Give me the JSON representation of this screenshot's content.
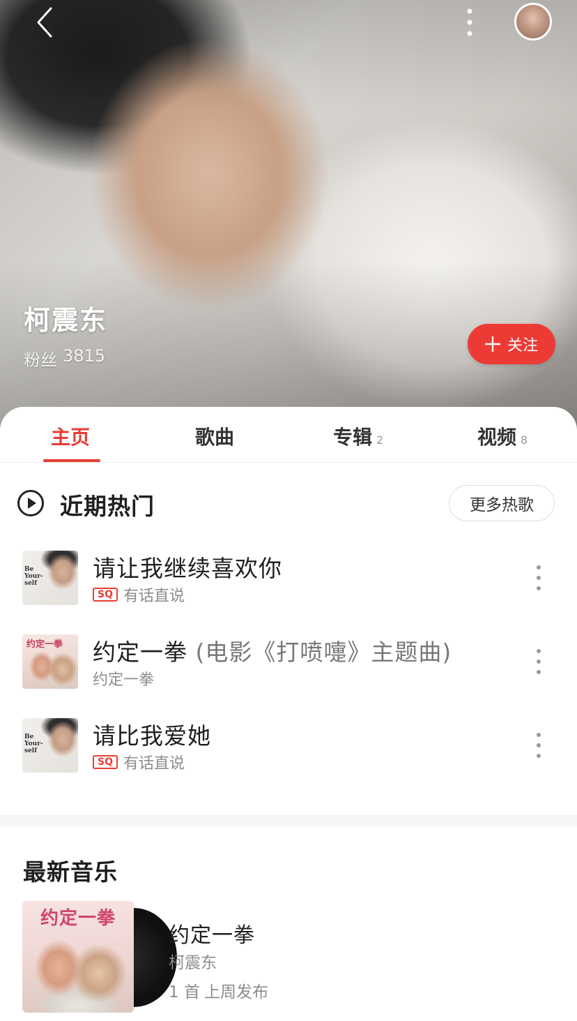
{
  "artist": {
    "name": "柯震东",
    "fans_label": "粉丝",
    "fans_count": "3815",
    "follow_label": "关注",
    "follow_icon": "plus-icon"
  },
  "header": {
    "back_icon": "chevron-left-icon",
    "more_icon": "vertical-dots-icon"
  },
  "tabs": [
    {
      "label": "主页",
      "count": ""
    },
    {
      "label": "歌曲",
      "count": ""
    },
    {
      "label": "专辑",
      "count": "2"
    },
    {
      "label": "视频",
      "count": "8"
    }
  ],
  "hot": {
    "title": "近期热门",
    "more_label": "更多热歌",
    "songs": [
      {
        "title": "请让我继续喜欢你",
        "suffix": "",
        "badge": "SQ",
        "album": "有话直说"
      },
      {
        "title": "约定一拳",
        "suffix": " (电影《打喷嚏》主题曲)",
        "badge": "",
        "album": "约定一拳"
      },
      {
        "title": "请比我爱她",
        "suffix": "",
        "badge": "SQ",
        "album": "有话直说"
      }
    ]
  },
  "cover_art": {
    "be_yourself": "Be\nYour-\nself",
    "yueding_cover": "约定一拳"
  },
  "latest": {
    "title": "最新音乐",
    "album_name": "约定一拳",
    "artist": "柯震东",
    "track_count": "1 首",
    "release": "上周发布"
  },
  "colors": {
    "accent": "#ea3d35",
    "follow_button": "#ee3a35"
  }
}
